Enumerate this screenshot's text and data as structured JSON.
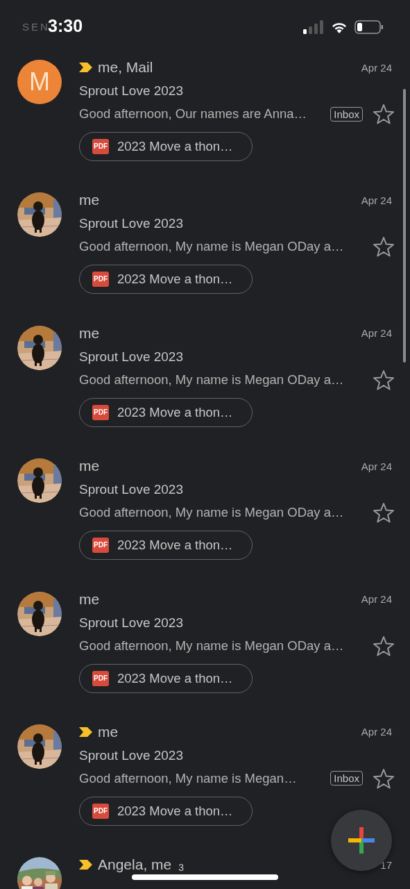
{
  "status_bar": {
    "ghost_text": "SEN",
    "time": "3:30"
  },
  "threads": [
    {
      "avatar": {
        "kind": "letter",
        "letter": "M",
        "color": "#ec8537"
      },
      "important": true,
      "senders": "me, Mail",
      "date": "Apr 24",
      "subject": "Sprout Love 2023",
      "snippet": "Good afternoon, Our names are Anna…",
      "label": "Inbox",
      "starred": false,
      "attachment": {
        "type_label": "PDF",
        "name": "2023 Move a thon…"
      }
    },
    {
      "important": false,
      "senders": "me",
      "date": "Apr 24",
      "subject": "Sprout Love 2023",
      "snippet": "Good afternoon, My name is Megan ODay a…",
      "starred": false,
      "attachment": {
        "type_label": "PDF",
        "name": "2023 Move a thon…"
      }
    },
    {
      "important": false,
      "senders": "me",
      "date": "Apr 24",
      "subject": "Sprout Love 2023",
      "snippet": "Good afternoon, My name is Megan ODay a…",
      "starred": false,
      "attachment": {
        "type_label": "PDF",
        "name": "2023 Move a thon…"
      }
    },
    {
      "important": false,
      "senders": "me",
      "date": "Apr 24",
      "subject": "Sprout Love 2023",
      "snippet": "Good afternoon, My name is Megan ODay a…",
      "starred": false,
      "attachment": {
        "type_label": "PDF",
        "name": "2023 Move a thon…"
      }
    },
    {
      "important": false,
      "senders": "me",
      "date": "Apr 24",
      "subject": "Sprout Love 2023",
      "snippet": "Good afternoon, My name is Megan ODay a…",
      "starred": false,
      "attachment": {
        "type_label": "PDF",
        "name": "2023 Move a thon…"
      }
    },
    {
      "important": true,
      "senders": "me",
      "date": "Apr 24",
      "subject": "Sprout Love 2023",
      "snippet": "Good afternoon, My name is Megan…",
      "label": "Inbox",
      "starred": false,
      "attachment": {
        "type_label": "PDF",
        "name": "2023 Move a thon…"
      }
    },
    {
      "avatar": {
        "kind": "group_picture"
      },
      "important": true,
      "senders": "Angela, me",
      "count": "3",
      "date": "17"
    }
  ]
}
